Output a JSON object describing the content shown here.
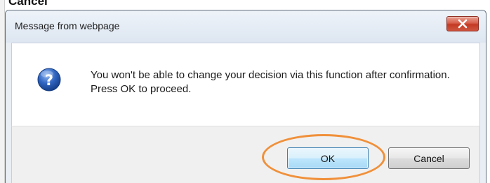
{
  "page": {
    "fragment_text": "Cancel\""
  },
  "dialog": {
    "title": "Message from webpage",
    "message": "You won't be able to change your decision via this function after confirmation. Press OK to proceed.",
    "buttons": {
      "ok_label": "OK",
      "cancel_label": "Cancel"
    },
    "icons": {
      "message_icon": "question-icon",
      "close_icon": "close-icon"
    },
    "colors": {
      "close_button": "#c94a35",
      "icon_blue": "#2f64c0",
      "highlight_annotation": "#f0903a"
    }
  }
}
